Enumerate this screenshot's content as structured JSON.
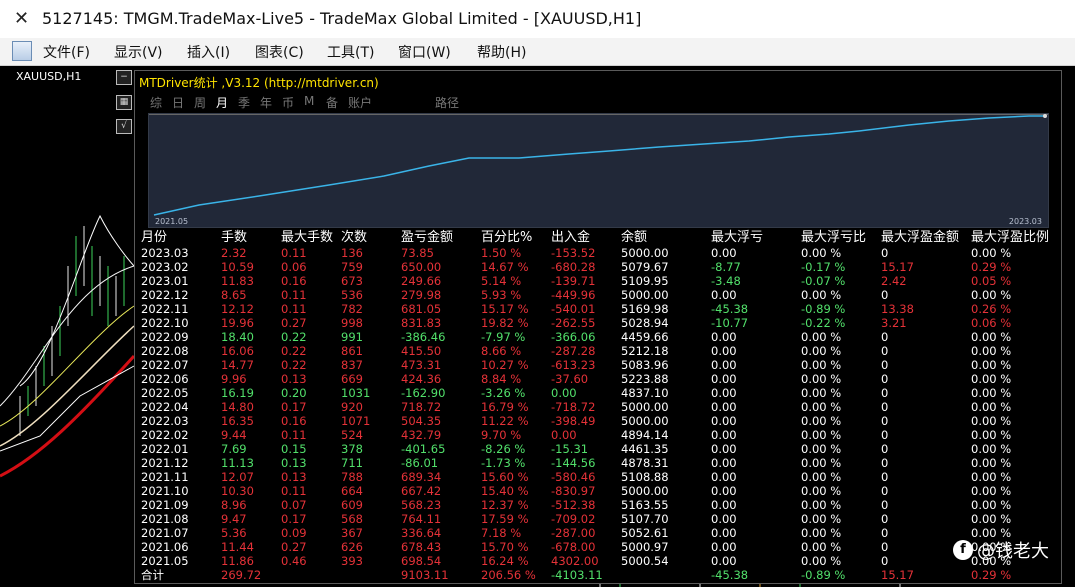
{
  "window": {
    "title": "5127145: TMGM.TradeMax-Live5 - TradeMax Global Limited - [XAUUSD,H1]"
  },
  "menu": [
    "文件(F)",
    "显示(V)",
    "插入(I)",
    "图表(C)",
    "工具(T)",
    "窗口(W)",
    "帮助(H)"
  ],
  "chart": {
    "symbol": "XAUUSD,H1"
  },
  "panel": {
    "title": "MTDriver统计 ,V3.12 (http://mtdriver.cn)",
    "tabs": [
      "综",
      "日",
      "周",
      "月",
      "季",
      "年",
      "币",
      "M",
      "备",
      "账户",
      "路径"
    ],
    "active_tab": "月",
    "graph_labels": {
      "start": "2021.05",
      "end": "2023.03"
    }
  },
  "table": {
    "headers": [
      "月份",
      "手数",
      "最大手数",
      "次数",
      "盈亏金额",
      "百分比%",
      "出入金",
      "余额",
      "最大浮亏",
      "最大浮亏比",
      "最大浮盈金额",
      "最大浮盈比例"
    ],
    "rows": [
      [
        "2023.03",
        "2.32",
        "0.11",
        "136",
        "73.85",
        "1.50 %",
        "-153.52",
        "5000.00",
        "0.00",
        "0.00 %",
        "0",
        "0.00 %"
      ],
      [
        "2023.02",
        "10.59",
        "0.06",
        "759",
        "650.00",
        "14.67 %",
        "-680.28",
        "5079.67",
        "-8.77",
        "-0.17 %",
        "15.17",
        "0.29 %"
      ],
      [
        "2023.01",
        "11.83",
        "0.16",
        "673",
        "249.66",
        "5.14 %",
        "-139.71",
        "5109.95",
        "-3.48",
        "-0.07 %",
        "2.42",
        "0.05 %"
      ],
      [
        "2022.12",
        "8.65",
        "0.11",
        "536",
        "279.98",
        "5.93 %",
        "-449.96",
        "5000.00",
        "0.00",
        "0.00 %",
        "0",
        "0.00 %"
      ],
      [
        "2022.11",
        "12.12",
        "0.11",
        "782",
        "681.05",
        "15.17 %",
        "-540.01",
        "5169.98",
        "-45.38",
        "-0.89 %",
        "13.38",
        "0.26 %"
      ],
      [
        "2022.10",
        "19.96",
        "0.27",
        "998",
        "831.83",
        "19.82 %",
        "-262.55",
        "5028.94",
        "-10.77",
        "-0.22 %",
        "3.21",
        "0.06 %"
      ],
      [
        "2022.09",
        "18.40",
        "0.22",
        "991",
        "-386.46",
        "-7.97 %",
        "-366.06",
        "4459.66",
        "0.00",
        "0.00 %",
        "0",
        "0.00 %"
      ],
      [
        "2022.08",
        "16.06",
        "0.22",
        "861",
        "415.50",
        "8.66 %",
        "-287.28",
        "5212.18",
        "0.00",
        "0.00 %",
        "0",
        "0.00 %"
      ],
      [
        "2022.07",
        "14.77",
        "0.22",
        "837",
        "473.31",
        "10.27 %",
        "-613.23",
        "5083.96",
        "0.00",
        "0.00 %",
        "0",
        "0.00 %"
      ],
      [
        "2022.06",
        "9.96",
        "0.13",
        "669",
        "424.36",
        "8.84 %",
        "-37.60",
        "5223.88",
        "0.00",
        "0.00 %",
        "0",
        "0.00 %"
      ],
      [
        "2022.05",
        "16.19",
        "0.20",
        "1031",
        "-162.90",
        "-3.26 %",
        "0.00",
        "4837.10",
        "0.00",
        "0.00 %",
        "0",
        "0.00 %"
      ],
      [
        "2022.04",
        "14.80",
        "0.17",
        "920",
        "718.72",
        "16.79 %",
        "-718.72",
        "5000.00",
        "0.00",
        "0.00 %",
        "0",
        "0.00 %"
      ],
      [
        "2022.03",
        "16.35",
        "0.16",
        "1071",
        "504.35",
        "11.22 %",
        "-398.49",
        "5000.00",
        "0.00",
        "0.00 %",
        "0",
        "0.00 %"
      ],
      [
        "2022.02",
        "9.44",
        "0.11",
        "524",
        "432.79",
        "9.70 %",
        "0.00",
        "4894.14",
        "0.00",
        "0.00 %",
        "0",
        "0.00 %"
      ],
      [
        "2022.01",
        "7.69",
        "0.15",
        "378",
        "-401.65",
        "-8.26 %",
        "-15.31",
        "4461.35",
        "0.00",
        "0.00 %",
        "0",
        "0.00 %"
      ],
      [
        "2021.12",
        "11.13",
        "0.13",
        "711",
        "-86.01",
        "-1.73 %",
        "-144.56",
        "4878.31",
        "0.00",
        "0.00 %",
        "0",
        "0.00 %"
      ],
      [
        "2021.11",
        "12.07",
        "0.13",
        "788",
        "689.34",
        "15.60 %",
        "-580.46",
        "5108.88",
        "0.00",
        "0.00 %",
        "0",
        "0.00 %"
      ],
      [
        "2021.10",
        "10.30",
        "0.11",
        "664",
        "667.42",
        "15.40 %",
        "-830.97",
        "5000.00",
        "0.00",
        "0.00 %",
        "0",
        "0.00 %"
      ],
      [
        "2021.09",
        "8.96",
        "0.07",
        "609",
        "568.23",
        "12.37 %",
        "-512.38",
        "5163.55",
        "0.00",
        "0.00 %",
        "0",
        "0.00 %"
      ],
      [
        "2021.08",
        "9.47",
        "0.17",
        "568",
        "764.11",
        "17.59 %",
        "-709.02",
        "5107.70",
        "0.00",
        "0.00 %",
        "0",
        "0.00 %"
      ],
      [
        "2021.07",
        "5.36",
        "0.09",
        "367",
        "336.64",
        "7.18 %",
        "-287.00",
        "5052.61",
        "0.00",
        "0.00 %",
        "0",
        "0.00 %"
      ],
      [
        "2021.06",
        "11.44",
        "0.27",
        "626",
        "678.43",
        "15.70 %",
        "-678.00",
        "5000.97",
        "0.00",
        "0.00 %",
        "0",
        "0.00 %"
      ],
      [
        "2021.05",
        "11.86",
        "0.46",
        "393",
        "698.54",
        "16.24 %",
        "4302.00",
        "5000.54",
        "0.00",
        "0.00 %",
        "0",
        "0.00 %"
      ]
    ],
    "total": [
      "合计",
      "269.72",
      "",
      "",
      "9103.11",
      "206.56 %",
      "-4103.11",
      "",
      "-45.38",
      "-0.89 %",
      "15.17",
      "0.29 %"
    ]
  },
  "colors": {
    "profit": "#e53238",
    "loss": "#52e06b",
    "graph_bg": "#212838",
    "graph_line": "#3ab4e8",
    "title_yellow": "#ffe400"
  },
  "watermark": {
    "text": "@钱老大"
  }
}
